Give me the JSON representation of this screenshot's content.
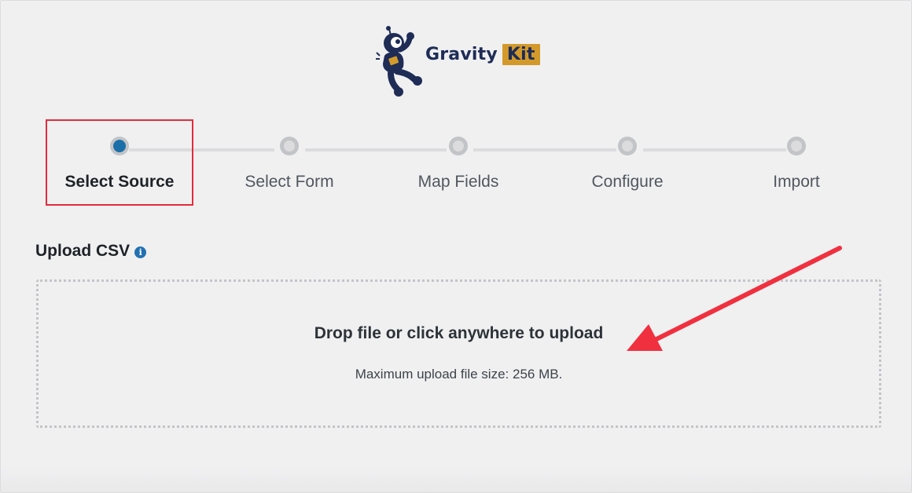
{
  "logo": {
    "word": "Gravity",
    "kit": "Kit"
  },
  "stepper": {
    "steps": [
      {
        "label": "Select Source",
        "active": true
      },
      {
        "label": "Select Form",
        "active": false
      },
      {
        "label": "Map Fields",
        "active": false
      },
      {
        "label": "Configure",
        "active": false
      },
      {
        "label": "Import",
        "active": false
      }
    ]
  },
  "upload": {
    "title": "Upload CSV",
    "info_icon": "info-icon",
    "drop_text": "Drop file or click anywhere to upload",
    "max_size_text": "Maximum upload file size: 256 MB."
  },
  "colors": {
    "active_step": "#1a6fa8",
    "annotation_red": "#e22c3b",
    "brand_navy": "#1e2c56",
    "brand_gold": "#d39a2b"
  }
}
